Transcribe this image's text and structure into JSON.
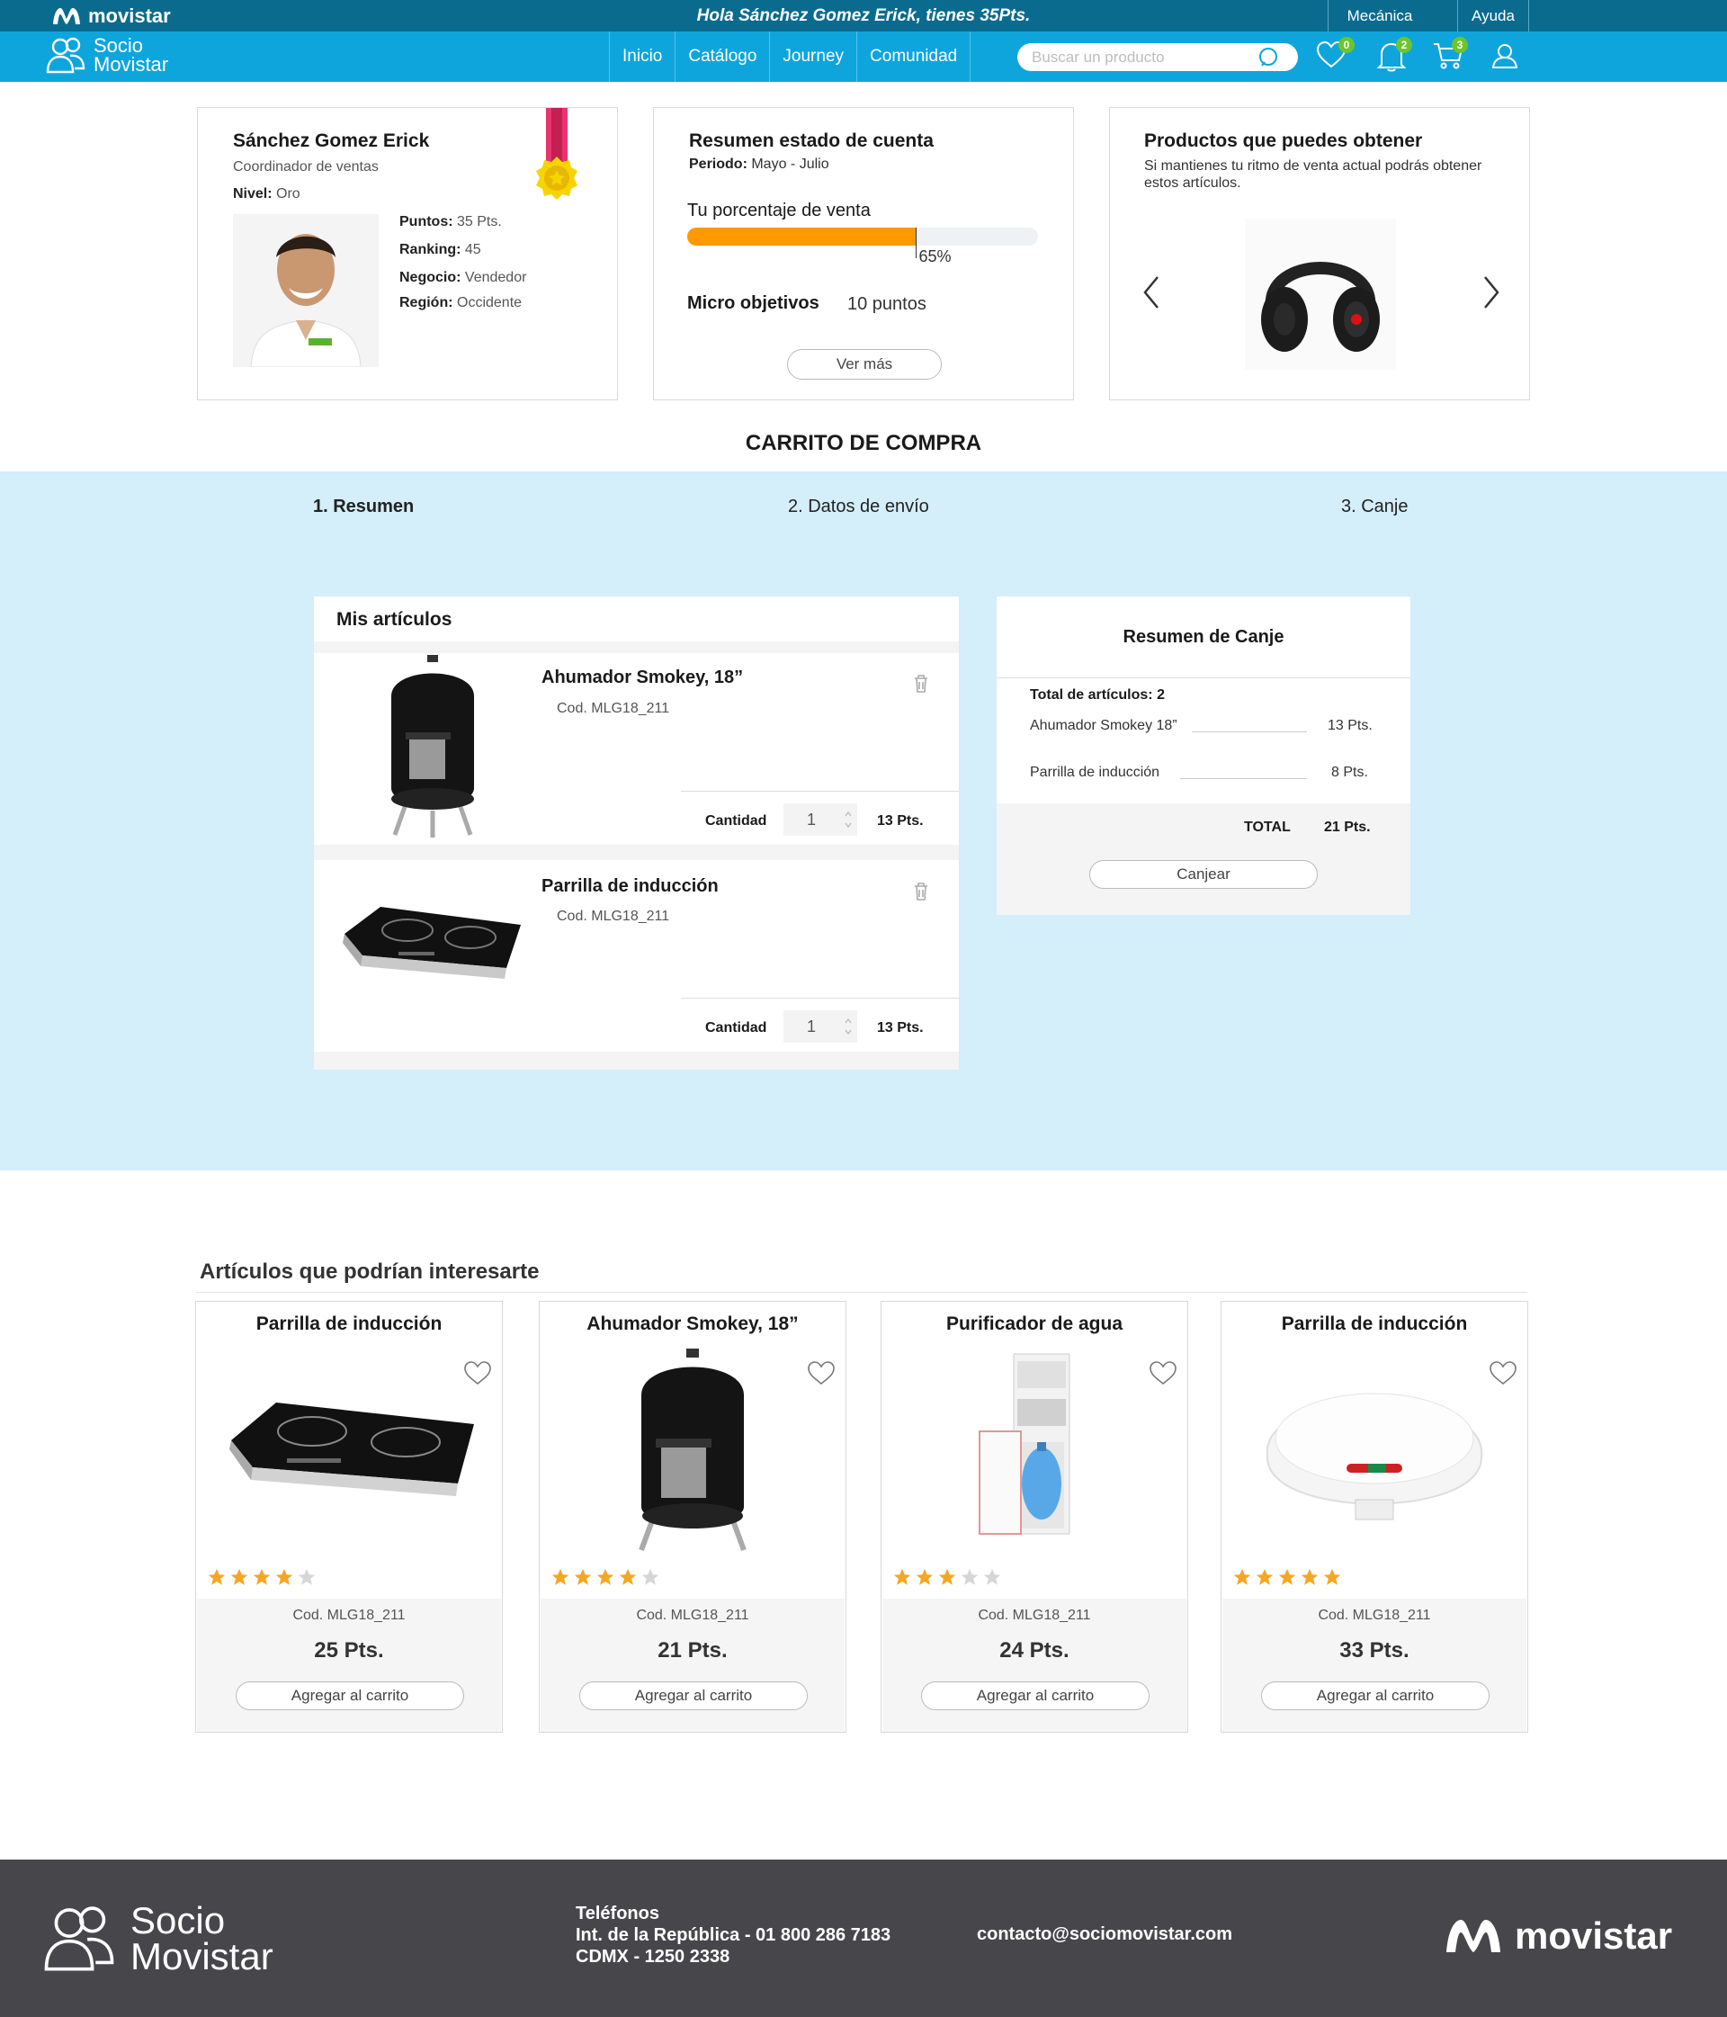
{
  "topbar": {
    "logo_text": "movistar",
    "greeting": "Hola Sánchez Gomez Erick, tienes 35Pts.",
    "links": [
      "Mecánica",
      "Ayuda"
    ]
  },
  "brand": {
    "line1": "Socio",
    "line2": "Movistar"
  },
  "nav": {
    "links": [
      "Inicio",
      "Catálogo",
      "Journey",
      "Comunidad"
    ],
    "search_placeholder": "Buscar un producto",
    "favorites_count": "0",
    "notifications_count": "2",
    "cart_count": "3"
  },
  "profile": {
    "name": "Sánchez Gomez Erick",
    "role": "Coordinador de ventas",
    "level_label": "Nivel:",
    "level": "Oro",
    "points_label": "Puntos:",
    "points": "35 Pts.",
    "ranking_label": "Ranking:",
    "ranking": "45",
    "business_label": "Negocio:",
    "business": "Vendedor",
    "region_label": "Región:",
    "region": "Occidente"
  },
  "account": {
    "title": "Resumen estado de cuenta",
    "period_label": "Periodo:",
    "period": "Mayo - Julio",
    "sales_label": "Tu porcentaje de venta",
    "sales_percent": 65,
    "sales_percent_text": "65%",
    "micro_label": "Micro objetivos",
    "micro_value": "10 puntos",
    "more_button": "Ver más"
  },
  "rewards": {
    "title": "Productos que puedes obtener",
    "text": "Si mantienes tu ritmo de venta actual podrás obtener estos artículos."
  },
  "cart": {
    "title": "CARRITO DE COMPRA",
    "steps": [
      "1. Resumen",
      "2. Datos de envío",
      "3. Canje"
    ],
    "items_title": "Mis artículos",
    "qty_label": "Cantidad",
    "items": [
      {
        "name": "Ahumador Smokey, 18”",
        "code": "Cod. MLG18_211",
        "qty": "1",
        "points": "13 Pts."
      },
      {
        "name": "Parrilla de inducción",
        "code": "Cod. MLG18_211",
        "qty": "1",
        "points": "13 Pts."
      }
    ]
  },
  "summary": {
    "title": "Resumen de Canje",
    "total_items_label": "Total de artículos:",
    "total_items": "2",
    "lines": [
      {
        "name": "Ahumador Smokey 18”",
        "points": "13 Pts."
      },
      {
        "name": "Parrilla de inducción",
        "points": "8 Pts."
      }
    ],
    "total_label": "TOTAL",
    "total": "21 Pts.",
    "button": "Canjear"
  },
  "suggested": {
    "title": "Artículos que podrían interesarte",
    "add_label": "Agregar al carrito",
    "products": [
      {
        "name": "Parrilla de inducción",
        "code": "Cod. MLG18_211",
        "price": "25 Pts.",
        "rating": 4
      },
      {
        "name": "Ahumador Smokey, 18”",
        "code": "Cod. MLG18_211",
        "price": "21 Pts.",
        "rating": 4
      },
      {
        "name": "Purificador de agua",
        "code": "Cod. MLG18_211",
        "price": "24 Pts.",
        "rating": 3
      },
      {
        "name": "Parrilla de inducción",
        "code": "Cod. MLG18_211",
        "price": "33 Pts.",
        "rating": 5
      }
    ]
  },
  "footer": {
    "brand1": "Socio",
    "brand2": "Movistar",
    "phones_title": "Teléfonos",
    "phone1": "Int. de la República - 01 800 286 7183",
    "phone2": "CDMX - 1250 2338",
    "email": "contacto@sociomovistar.com",
    "logo_text": "movistar"
  },
  "colors": {
    "topbar": "#0a6b8f",
    "navbar": "#0ea5dd",
    "band": "#d4eefa",
    "progress": "#ff9900",
    "badge": "#6ec42d",
    "footer": "#47474b",
    "star": "#f5a623"
  }
}
